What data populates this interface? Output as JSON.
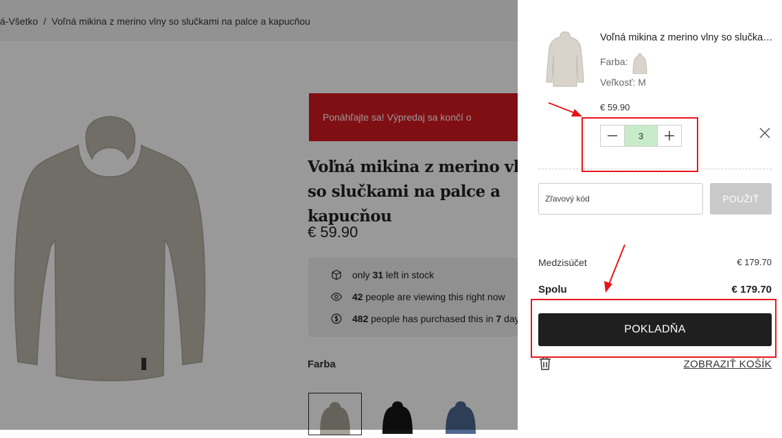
{
  "breadcrumb": {
    "parent": "á-Všetko",
    "separator": "/",
    "current": "Voľná mikina z merino vlny so slučkami na palce a kapucňou"
  },
  "product": {
    "sale_banner": "Ponáhľajte sa! Výpredaj sa končí o",
    "title": "Voľná mikina z merino vlny so slučkami na palce a kapucňou",
    "price": "€ 59.90",
    "stock": [
      {
        "icon": "box-icon",
        "count": "31",
        "pre": "only ",
        "post": " left in stock"
      },
      {
        "icon": "eye-icon",
        "count": "42",
        "pre": "",
        "post": " people are viewing this right now"
      },
      {
        "icon": "dollar-coin-icon",
        "count": "482",
        "pre": "",
        "post": " people has purchased this in ",
        "extra": "7",
        "extra_post": " days"
      }
    ],
    "color_label": "Farba",
    "swatch_colors": [
      "#a8a398",
      "#141414",
      "#4e6890"
    ]
  },
  "cart": {
    "item": {
      "name": "Voľná mikina z merino vlny so slučkami na palce a kapucňou",
      "color_label": "Farba:",
      "size": "Veľkosť: M",
      "price": "€ 59.90",
      "quantity": "3"
    },
    "discount_placeholder": "Zľavový kód",
    "apply_label": "POUŽIŤ",
    "subtotal_label": "Medzisúčet",
    "subtotal_value": "€ 179.70",
    "total_label": "Spolu",
    "total_value": "€ 179.70",
    "checkout_label": "POKLADŇA",
    "view_cart_label": "ZOBRAZIŤ KOŠÍK"
  },
  "colors": {
    "sale_red": "#d51920",
    "checkout_dark": "#1f1f1f",
    "qty_highlight": "#c8ecc9",
    "annotation_red": "#e8141a"
  }
}
